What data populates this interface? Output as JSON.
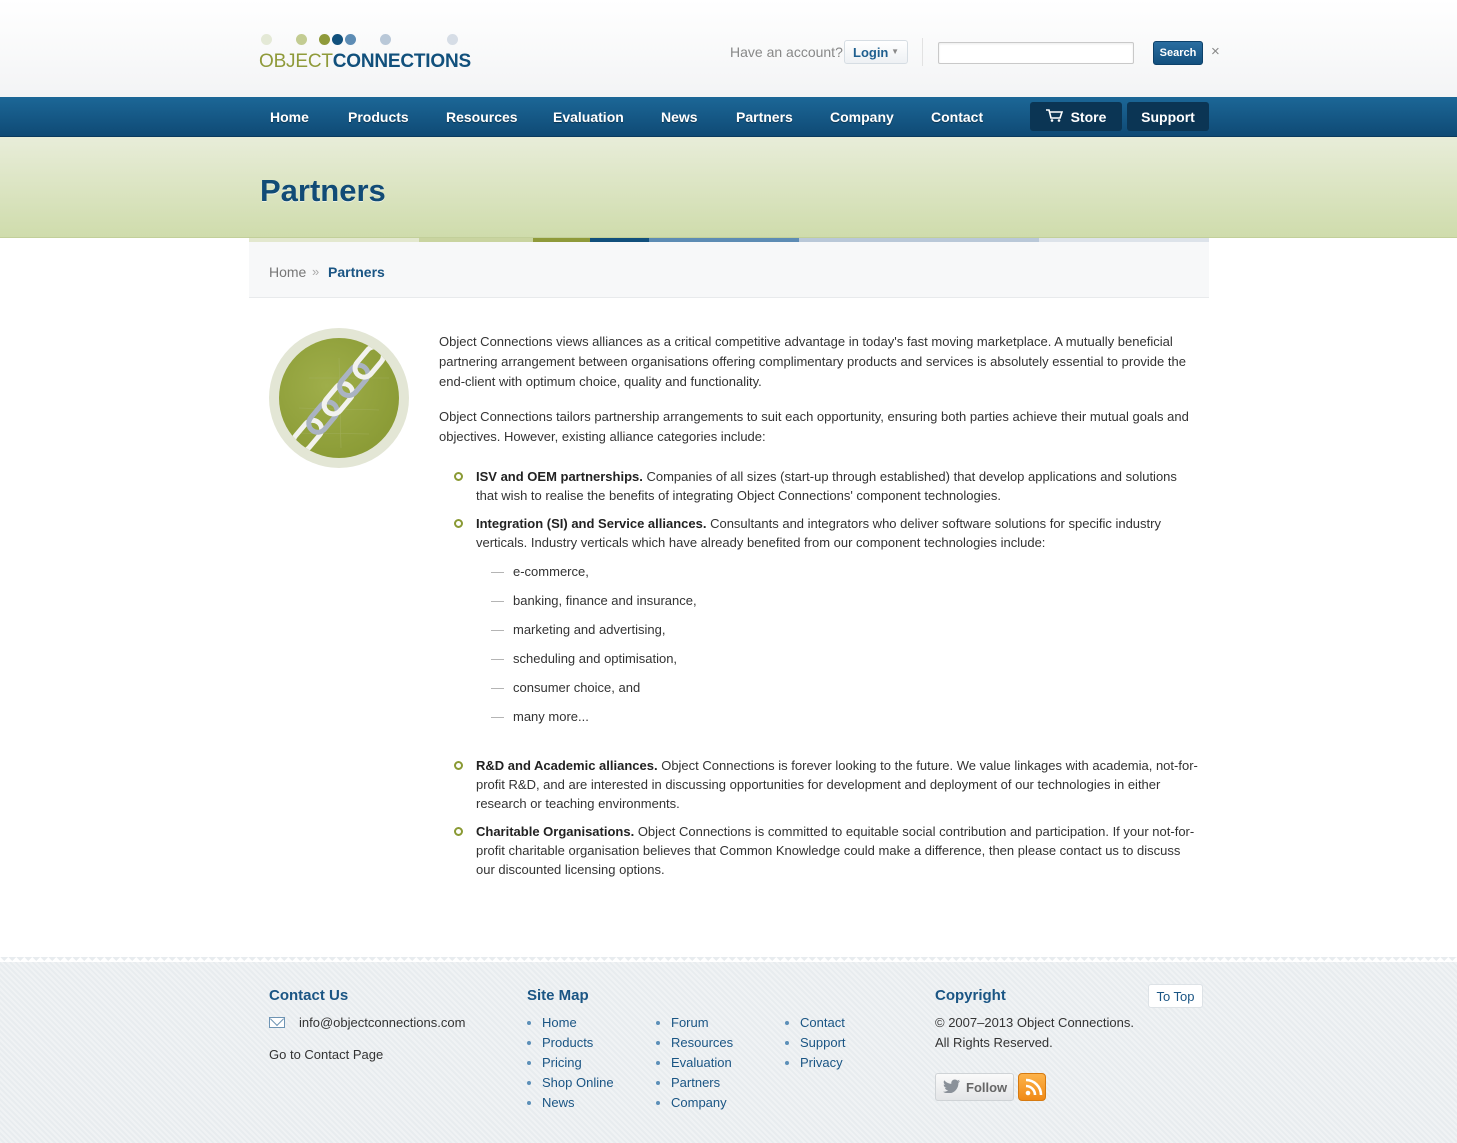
{
  "header": {
    "logo_part1": "OBJECT",
    "logo_part2": "CONNECTIONS",
    "account_text": "Have an account?",
    "login_label": "Login",
    "search_value": "",
    "search_button": "Search",
    "close_glyph": "×"
  },
  "nav": {
    "items": [
      "Home",
      "Products",
      "Resources",
      "Evaluation",
      "News",
      "Partners",
      "Company",
      "Contact"
    ],
    "store_label": "Store",
    "support_label": "Support"
  },
  "page": {
    "title": "Partners"
  },
  "breadcrumb": {
    "home": "Home",
    "separator": "»",
    "current": "Partners"
  },
  "content": {
    "intro1": "Object Connections views alliances as a critical competitive advantage in today's fast moving marketplace. A mutually beneficial partnering arrangement between organisations offering complimentary products and services is absolutely essential to provide the end-client with optimum choice, quality and functionality.",
    "intro2": "Object Connections tailors partnership arrangements to suit each opportunity, ensuring both parties achieve their mutual goals and objectives. However, existing alliance categories include:",
    "categories": [
      {
        "title": "ISV and OEM partnerships.",
        "text": " Companies of all sizes (start-up through established) that develop applications and solutions that wish to realise the benefits of integrating Object Connections' component technologies."
      },
      {
        "title": "Integration (SI) and Service alliances.",
        "text": " Consultants and integrators who deliver software solutions for specific industry verticals. Industry verticals which have already benefited from our component technologies include:"
      },
      {
        "title": "R&D and Academic alliances.",
        "text": " Object Connections is forever looking to the future. We value linkages with academia, not-for-profit R&D, and are interested in discussing opportunities for development and deployment of our technologies in either research or teaching environments."
      },
      {
        "title": "Charitable Organisations.",
        "text": " Object Connections is committed to equitable social contribution and participation. If your not-for-profit charitable organisation believes that Common Knowledge could make a difference, then please contact us to discuss our discounted licensing options."
      }
    ],
    "verticals": [
      "e-commerce,",
      "banking, finance and insurance,",
      "marketing and advertising,",
      "scheduling and optimisation,",
      "consumer choice, and",
      "many more..."
    ]
  },
  "footer": {
    "contact_heading": "Contact Us",
    "email": "info@objectconnections.com",
    "contact_link": "Go to Contact Page",
    "sitemap_heading": "Site Map",
    "sitemap_col1": [
      "Home",
      "Products",
      "Pricing",
      "Shop Online",
      "News"
    ],
    "sitemap_col2": [
      "Forum",
      "Resources",
      "Evaluation",
      "Partners",
      "Company"
    ],
    "sitemap_col3": [
      "Contact",
      "Support",
      "Privacy"
    ],
    "copyright_heading": "Copyright",
    "copyright_line1": "© 2007–2013 Object Connections.",
    "copyright_line2": "All Rights Reserved.",
    "to_top": "To Top",
    "follow_label": "Follow"
  },
  "colors": {
    "brand_blue": "#11507c",
    "brand_green": "#8f9a3a",
    "nav_blue": "#1c6797"
  },
  "icons": [
    "cart-icon",
    "close-icon",
    "mail-icon",
    "twitter-bird-icon",
    "rss-icon",
    "chain-link-icon"
  ]
}
